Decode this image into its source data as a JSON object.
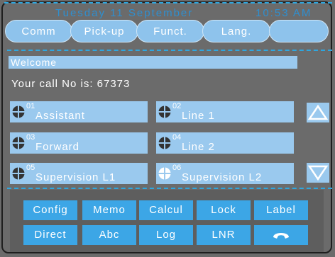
{
  "header": {
    "date": "Tuesday 11 September",
    "time": "10:53 AM"
  },
  "tabs": [
    {
      "label": "Comm"
    },
    {
      "label": "Pick-up"
    },
    {
      "label": "Funct."
    },
    {
      "label": "Lang."
    },
    {
      "label": ""
    }
  ],
  "welcome": "Welcome",
  "call_number": "Your call No is: 67373",
  "lines": [
    {
      "num": "01",
      "label": "Assistant"
    },
    {
      "num": "02",
      "label": "Line 1"
    },
    {
      "num": "03",
      "label": "Forward"
    },
    {
      "num": "04",
      "label": "Line 2"
    },
    {
      "num": "05",
      "label": "Supervision L1"
    },
    {
      "num": "06",
      "label": "Supervision L2"
    }
  ],
  "keys_row1": [
    "Config",
    "Memo",
    "Calcul",
    "Lock",
    "Label"
  ],
  "keys_row2": [
    "Direct",
    "Abc",
    "Log",
    "LNR",
    ""
  ],
  "icons": {
    "line": "globe-icon",
    "scroll_up": "arrow-up-icon",
    "scroll_down": "arrow-down-icon",
    "hangup": "handset-icon"
  },
  "colors": {
    "accent": "#3ca6e6",
    "tab_bg": "#8ec3ec",
    "line_bg": "#9ac9ee",
    "background": "#6b6b6b",
    "dashed_separator": "#2ea7e0"
  }
}
